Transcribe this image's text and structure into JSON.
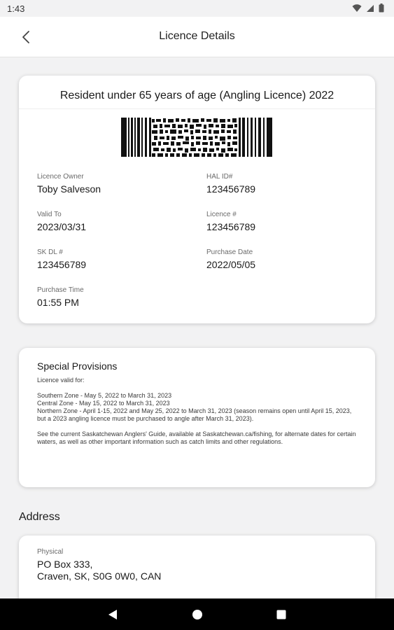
{
  "status_bar": {
    "time": "1:43"
  },
  "header": {
    "title": "Licence Details"
  },
  "licence": {
    "title": "Resident under 65 years of age (Angling Licence) 2022",
    "fields": {
      "owner": {
        "label": "Licence Owner",
        "value": "Toby Salveson"
      },
      "hal_id": {
        "label": "HAL ID#",
        "value": "123456789"
      },
      "valid_to": {
        "label": "Valid To",
        "value": "2023/03/31"
      },
      "licence_no": {
        "label": "Licence #",
        "value": "123456789"
      },
      "sk_dl": {
        "label": "SK DL #",
        "value": "123456789"
      },
      "purchase_date": {
        "label": "Purchase Date",
        "value": "2022/05/05"
      },
      "purchase_time": {
        "label": "Purchase Time",
        "value": "01:55 PM"
      }
    }
  },
  "provisions": {
    "title": "Special Provisions",
    "intro": "Licence valid for:",
    "southern": "Southern Zone - May 5, 2022 to March 31, 2023",
    "central": "Central Zone - May 15, 2022 to March 31, 2023",
    "northern": "Northern Zone - April 1-15, 2022 and May 25, 2022 to March 31, 2023 (season remains open until April 15, 2023, but a 2023 angling licence must be purchased to angle after March 31, 2023).",
    "guide": "See the current Saskatchewan Anglers' Guide, available at Saskatchewan.ca/fishing, for alternate dates for certain waters, as well as other important information such as catch limits and other regulations."
  },
  "address": {
    "section_title": "Address",
    "physical_label": "Physical",
    "line1": "PO Box 333,",
    "line2": "Craven, SK, S0G 0W0, CAN"
  },
  "icons": {
    "back": "chevron-left-icon",
    "wifi": "wifi-icon",
    "signal": "signal-icon",
    "battery": "battery-icon",
    "nav_back": "triangle-back-icon",
    "nav_home": "circle-home-icon",
    "nav_recents": "square-recents-icon"
  },
  "colors": {
    "background": "#f2f2f3",
    "card": "#ffffff",
    "navbar": "#000000"
  }
}
